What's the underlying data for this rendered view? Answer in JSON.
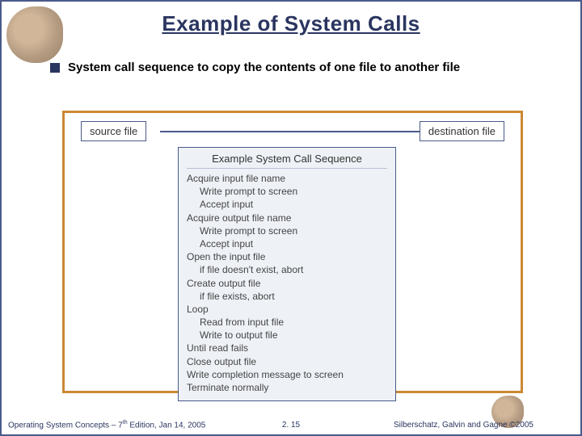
{
  "title": "Example of System Calls",
  "bullet": "System call sequence to copy the contents of one file to another file",
  "diagram": {
    "source_label": "source file",
    "dest_label": "destination  file",
    "box_title": "Example System Call Sequence",
    "lines": {
      "l1": "Acquire input file name",
      "l2": "Write prompt to screen",
      "l3": "Accept input",
      "l4": "Acquire output file name",
      "l5": "Write prompt to screen",
      "l6": "Accept input",
      "l7": "Open the input file",
      "l8": "if file doesn't exist, abort",
      "l9": "Create output file",
      "l10": "if file exists, abort",
      "l11": "Loop",
      "l12": "Read from input file",
      "l13": "Write to output file",
      "l14": "Until read fails",
      "l15": "Close output file",
      "l16": "Write completion message to screen",
      "l17": "Terminate normally"
    }
  },
  "footer": {
    "left_prefix": "Operating System Concepts – 7",
    "left_sup": "th",
    "left_suffix": " Edition, Jan 14, 2005",
    "center": "2. 15",
    "right_prefix": "Silberschatz, Galvin and Gagne ",
    "right_suffix": "2005",
    "copyright": "©"
  }
}
